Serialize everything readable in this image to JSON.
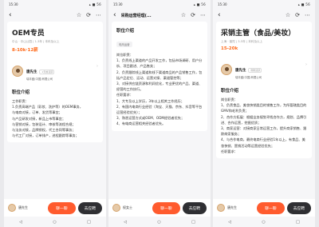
{
  "screens": [
    {
      "status": {
        "time": "15:30",
        "icons": "▴ ■ 56"
      },
      "nav": {
        "back": "‹",
        "title": ""
      },
      "job": {
        "title": "OEM专员",
        "meta": "中山 · 中山公园 | 1-3年 | 本科及以上",
        "salary": "8-10k·12薪"
      },
      "recruiter": {
        "name": "唐先生",
        "badge": "· 1天前活跃",
        "company": "瑞丰盛(中国)有限公司"
      },
      "section_title": "职位介绍",
      "tag": "",
      "desc": [
        "工作职责：",
        "1.负责高端产品（彩妆、洗护等）的OEM事务，",
        "与电商对接，订单、发货等事宜；",
        "与产品研发对接，新品上市等事宜；",
        "与营销对接，包装设计、审核等流程合规；",
        "与法务对接，品牌授权，代工合同等事务；",
        "与代工厂对接，订单排产，进程跟踪等事务；"
      ],
      "bottom": {
        "name": "唐先生",
        "chat": "聊一聊",
        "apply": "去应聘"
      }
    },
    {
      "status": {
        "time": "15:30",
        "icons": "▴ ■ 56"
      },
      "nav": {
        "back": "‹",
        "title": "采购运营经理(..."
      },
      "job": {
        "title": "",
        "meta": "",
        "salary": ""
      },
      "recruiter": {
        "name": "",
        "badge": "",
        "company": ""
      },
      "section_title": "职位介绍",
      "tag": "电商运营",
      "desc": [
        "岗位职责：",
        "1、负责线上渠道的产品开发工作，包括市场调研、用户分析、项目跟进、产品售卖；",
        "2、负责跟踪线上渠道和线下渠道商品的产品销售工作，包括产品定位、运动、运营对接、渠道管控等；",
        "3、对接供应链资源和利润优化，专业更优的产品、渠道、经营的工作执行。",
        "任职要求：",
        "1、大专及以上学历，3年以上相关工作经历；",
        "2、有国内电商行业经验（淘宝、天猫、京东、抖音等平台运营经验优先）；",
        "3、熟悉运营方式或OEM、ODM经验者优先；",
        "4、有电商运营相关经验者优先。"
      ],
      "bottom": {
        "name": "权女士",
        "chat": "聊一聊",
        "apply": "去应聘"
      }
    },
    {
      "status": {
        "time": "15:30",
        "icons": "▴ ■ 56"
      },
      "nav": {
        "back": "‹",
        "title": ""
      },
      "job": {
        "title": "采销主管（食品/美妆）",
        "meta": "上海 · 普陀 | 3-5年 | 本科及以上",
        "salary": "15-20k"
      },
      "recruiter": {
        "name": "唐先生",
        "badge": "· 刚刚活跃",
        "company": "瑞丰盛(中国)有限公司"
      },
      "section_title": "职位介绍",
      "tag": "",
      "desc": [
        "岗位职责：",
        "1、负责食品、美妆快销类目的销售工作，为所管辖类目的GMV和毛利负责；",
        "2、合作方拓展：根据业务规划寻找合作方，规划、品牌引进、合作运营，挖掘优质；",
        "3、商家运营：对接商家日常运营工作，提升商家销售、跟踪商家服务；",
        "4、与合作电商，最终电商行业经验1年以上，有食品、美妆快销、营销活动等运营经验优先；",
        "任职要求："
      ],
      "bottom": {
        "name": "唐先生",
        "chat": "聊一聊",
        "apply": "去应聘"
      }
    }
  ],
  "icons": {
    "back": "‹",
    "star": "☆",
    "share": "⟳",
    "more": "⋯",
    "sys_back": "◁",
    "sys_home": "○",
    "sys_recent": "□"
  },
  "colors": {
    "salary": "#ff6a1a",
    "chat_button": "#ff5b2e",
    "apply_button": "#2f2f33"
  }
}
